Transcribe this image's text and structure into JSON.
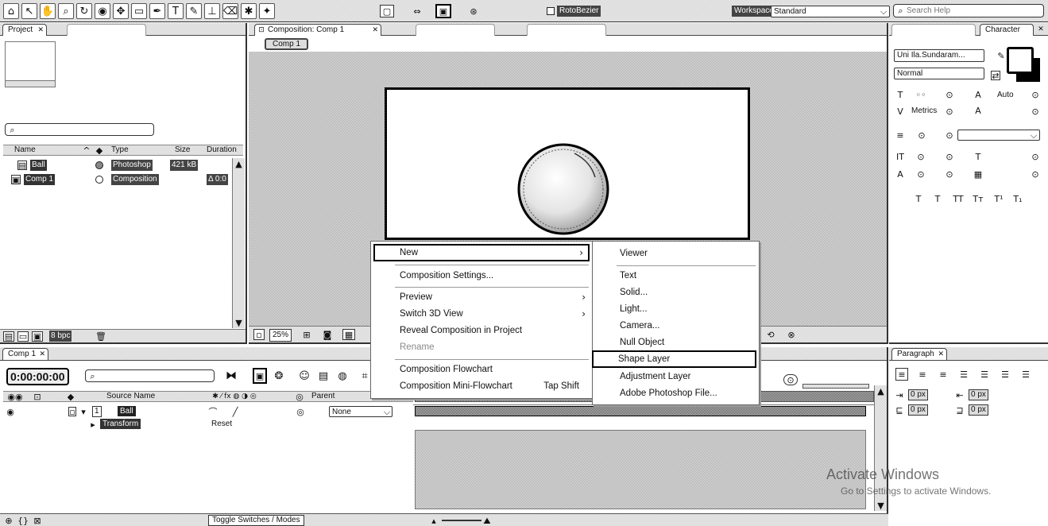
{
  "toolbar": {
    "tools": [
      "home-icon",
      "selection-tool-icon",
      "hand-tool-icon",
      "zoom-tool-icon",
      "rotate-tool-icon",
      "camera-tool-icon",
      "pan-behind-tool-icon",
      "rectangle-tool-icon",
      "pen-tool-icon",
      "text-tool-icon",
      "brush-tool-icon",
      "clone-stamp-tool-icon",
      "eraser-tool-icon",
      "roto-brush-tool-icon",
      "puppet-tool-icon"
    ],
    "rotobezier_label": "RotoBezier",
    "workspace_label": "Workspace:",
    "workspace_value": "Standard",
    "search_placeholder": "Search Help"
  },
  "project_panel": {
    "tab_label": "Project",
    "columns": {
      "name": "Name",
      "type": "Type",
      "size": "Size",
      "duration": "Duration"
    },
    "items": [
      {
        "name": "Ball",
        "type": "Photoshop",
        "size": "421 kB",
        "duration": "",
        "icon": "photoshop-file-icon"
      },
      {
        "name": "Comp 1",
        "type": "Composition",
        "size": "",
        "duration": "Δ 0:0",
        "icon": "composition-icon"
      }
    ],
    "bit_depth": "8 bpc"
  },
  "composition_panel": {
    "tab_label": "Composition: Comp 1",
    "breadcrumb": "Comp 1",
    "zoom": "25%"
  },
  "context_menu": {
    "submenu_arrow": "›",
    "items": [
      {
        "label": "New",
        "has_submenu": true,
        "highlighted": true
      },
      {
        "label": "Composition Settings..."
      },
      {
        "label": "Preview",
        "has_submenu": true
      },
      {
        "label": "Switch 3D View",
        "has_submenu": true
      },
      {
        "label": "Reveal Composition in Project"
      },
      {
        "label": "Rename",
        "disabled": true
      },
      {
        "label": "Composition Flowchart"
      },
      {
        "label": "Composition Mini-Flowchart",
        "shortcut": "Tap Shift"
      }
    ],
    "submenu": [
      {
        "label": "Viewer"
      },
      {
        "label": "Text"
      },
      {
        "label": "Solid..."
      },
      {
        "label": "Light..."
      },
      {
        "label": "Camera..."
      },
      {
        "label": "Null Object"
      },
      {
        "label": "Shape Layer",
        "highlighted": true
      },
      {
        "label": "Adjustment Layer"
      },
      {
        "label": "Adobe Photoshop File..."
      }
    ]
  },
  "character_panel": {
    "tab_label": "Character",
    "font_family": "Uni Ila.Sundaram...",
    "font_style": "Normal",
    "leading": "Auto",
    "kerning": "Metrics"
  },
  "timeline_panel": {
    "tab_label": "Comp 1",
    "current_time": "0:00:00:00",
    "columns": {
      "source_name": "Source Name",
      "parent": "Parent"
    },
    "layers": [
      {
        "number": "1",
        "name": "Ball",
        "parent": "None"
      }
    ],
    "property": {
      "name": "Transform",
      "value": "Reset"
    },
    "toggle_label": "Toggle Switches / Modes"
  },
  "paragraph_panel": {
    "tab_label": "Paragraph",
    "values": [
      "0 px",
      "0 px",
      "0 px",
      "0 px"
    ]
  },
  "watermark": {
    "title": "Activate Windows",
    "subtitle": "Go to Settings to activate Windows."
  }
}
